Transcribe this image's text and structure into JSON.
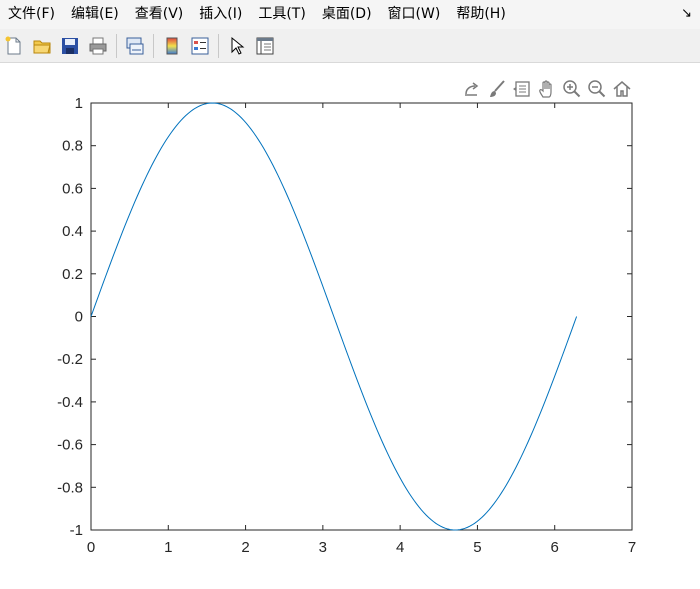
{
  "menu": {
    "items": [
      "文件(F)",
      "编辑(E)",
      "查看(V)",
      "插入(I)",
      "工具(T)",
      "桌面(D)",
      "窗口(W)",
      "帮助(H)"
    ],
    "dock_arrow": "↘"
  },
  "toolbar": {
    "icons": [
      "new-figure-icon",
      "open-file-icon",
      "save-icon",
      "print-icon",
      "link-plot-icon",
      "insert-colorbar-icon",
      "insert-legend-icon",
      "edit-plot-icon",
      "property-inspector-icon"
    ]
  },
  "axes_toolbar": {
    "icons": [
      "export-icon",
      "brush-icon",
      "data-tips-icon",
      "pan-icon",
      "zoom-in-icon",
      "zoom-out-icon",
      "home-icon"
    ]
  },
  "colors": {
    "line": "#0072bd",
    "axis": "#262626"
  },
  "chart_data": {
    "type": "line",
    "function": "sin(x)",
    "x_range": [
      0,
      6.2832
    ],
    "xlim": [
      0,
      7
    ],
    "ylim": [
      -1,
      1
    ],
    "xticks": [
      "0",
      "1",
      "2",
      "3",
      "4",
      "5",
      "6",
      "7"
    ],
    "yticks": [
      "-1",
      "-0.8",
      "-0.6",
      "-0.4",
      "-0.2",
      "0",
      "0.2",
      "0.4",
      "0.6",
      "0.8",
      "1"
    ],
    "series": [
      {
        "x": [
          0,
          0.5,
          1.0,
          1.5708,
          2.0,
          2.5,
          3.0,
          3.1416,
          3.5,
          4.0,
          4.7124,
          5.0,
          5.5,
          6.0,
          6.2832
        ],
        "y": [
          0,
          0.479,
          0.841,
          1.0,
          0.909,
          0.598,
          0.141,
          0,
          -0.351,
          -0.757,
          -1.0,
          -0.959,
          -0.706,
          -0.279,
          0
        ]
      }
    ],
    "grid": false,
    "box": true
  }
}
